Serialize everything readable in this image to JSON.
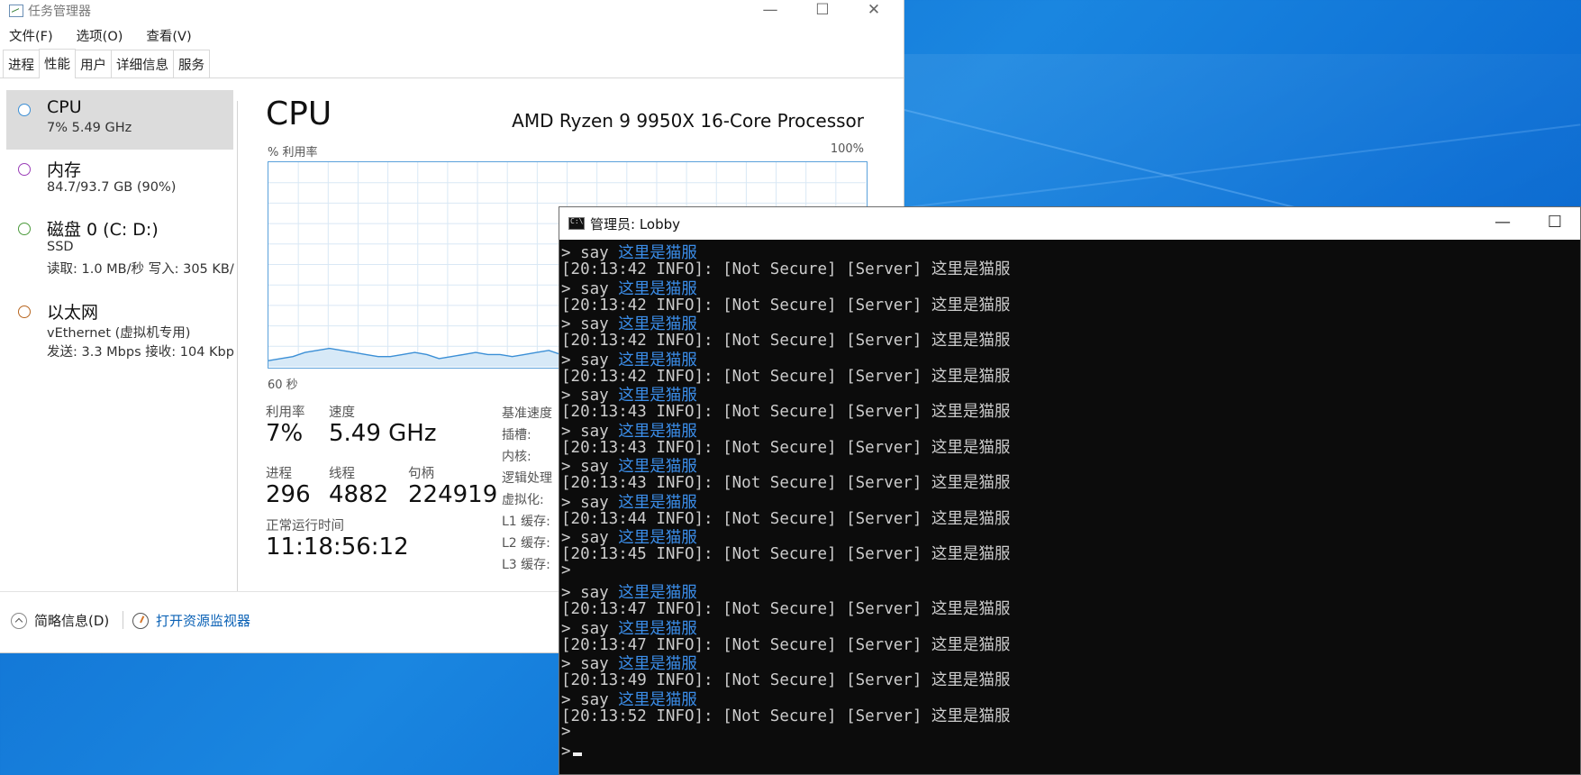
{
  "taskmgr": {
    "title": "任务管理器",
    "controls": {
      "minimize": "—",
      "maximize": "☐",
      "close": "✕"
    },
    "menu": [
      "文件(F)",
      "选项(O)",
      "查看(V)"
    ],
    "tabs": [
      "进程",
      "性能",
      "用户",
      "详细信息",
      "服务"
    ],
    "active_tab": "性能",
    "resources": [
      {
        "name": "CPU",
        "sub1": "7% 5.49 GHz",
        "sub2": ""
      },
      {
        "name": "内存",
        "sub1": "84.7/93.7 GB (90%)",
        "sub2": ""
      },
      {
        "name": "磁盘 0 (C: D:)",
        "sub1": "SSD",
        "sub2": "读取: 1.0 MB/秒 写入: 305 KB/"
      },
      {
        "name": "以太网",
        "sub1": "vEthernet (虚拟机专用)",
        "sub2": "发送: 3.3 Mbps 接收: 104 Kbp"
      }
    ],
    "cpu": {
      "title": "CPU",
      "model": "AMD Ryzen 9 9950X 16-Core Processor",
      "util_label": "% 利用率",
      "util_max": "100%",
      "time_label": "60 秒",
      "stats": {
        "util_label": "利用率",
        "util_value": "7%",
        "speed_label": "速度",
        "speed_value": "5.49 GHz",
        "proc_label": "进程",
        "proc_value": "296",
        "thread_label": "线程",
        "thread_value": "4882",
        "handle_label": "句柄",
        "handle_value": "224919",
        "uptime_label": "正常运行时间",
        "uptime_value": "11:18:56:12"
      },
      "details": [
        "基准速度",
        "插槽:",
        "内核:",
        "逻辑处理",
        "虚拟化:",
        "L1 缓存:",
        "L2 缓存:",
        "L3 缓存:"
      ],
      "graph_values_percent": [
        3,
        4,
        5,
        7,
        8,
        9,
        8,
        7,
        6,
        5,
        5,
        6,
        7,
        6,
        4,
        5,
        6,
        7,
        6,
        6,
        5,
        6,
        7,
        8,
        6,
        7,
        9,
        11,
        9,
        7,
        6,
        7,
        6,
        5,
        8,
        13,
        6,
        5,
        7,
        6,
        7,
        8,
        7,
        6,
        5,
        6,
        7,
        8,
        7,
        6
      ]
    },
    "footer": {
      "fewer_details": "简略信息(D)",
      "open_resmon": "打开资源监视器"
    }
  },
  "console": {
    "title": "管理员:  Lobby",
    "controls": {
      "minimize": "—",
      "maximize": "☐"
    },
    "lines": [
      {
        "type": "cmd",
        "prompt": "> say ",
        "text": "这里是猫服"
      },
      {
        "type": "log",
        "text": "[20:13:42 INFO]: [Not Secure] [Server] 这里是猫服"
      },
      {
        "type": "cmd",
        "prompt": "> say ",
        "text": "这里是猫服"
      },
      {
        "type": "log",
        "text": "[20:13:42 INFO]: [Not Secure] [Server] 这里是猫服"
      },
      {
        "type": "cmd",
        "prompt": "> say ",
        "text": "这里是猫服"
      },
      {
        "type": "log",
        "text": "[20:13:42 INFO]: [Not Secure] [Server] 这里是猫服"
      },
      {
        "type": "cmd",
        "prompt": "> say ",
        "text": "这里是猫服"
      },
      {
        "type": "log",
        "text": "[20:13:42 INFO]: [Not Secure] [Server] 这里是猫服"
      },
      {
        "type": "cmd",
        "prompt": "> say ",
        "text": "这里是猫服"
      },
      {
        "type": "log",
        "text": "[20:13:43 INFO]: [Not Secure] [Server] 这里是猫服"
      },
      {
        "type": "cmd",
        "prompt": "> say ",
        "text": "这里是猫服"
      },
      {
        "type": "log",
        "text": "[20:13:43 INFO]: [Not Secure] [Server] 这里是猫服"
      },
      {
        "type": "cmd",
        "prompt": "> say ",
        "text": "这里是猫服"
      },
      {
        "type": "log",
        "text": "[20:13:43 INFO]: [Not Secure] [Server] 这里是猫服"
      },
      {
        "type": "cmd",
        "prompt": "> say ",
        "text": "这里是猫服"
      },
      {
        "type": "log",
        "text": "[20:13:44 INFO]: [Not Secure] [Server] 这里是猫服"
      },
      {
        "type": "cmd",
        "prompt": "> say ",
        "text": "这里是猫服"
      },
      {
        "type": "log",
        "text": "[20:13:45 INFO]: [Not Secure] [Server] 这里是猫服"
      },
      {
        "type": "cmd",
        "prompt": ">",
        "text": ""
      },
      {
        "type": "cmd",
        "prompt": "> say ",
        "text": "这里是猫服"
      },
      {
        "type": "log",
        "text": "[20:13:47 INFO]: [Not Secure] [Server] 这里是猫服"
      },
      {
        "type": "cmd",
        "prompt": "> say ",
        "text": "这里是猫服"
      },
      {
        "type": "log",
        "text": "[20:13:47 INFO]: [Not Secure] [Server] 这里是猫服"
      },
      {
        "type": "cmd",
        "prompt": "> say ",
        "text": "这里是猫服"
      },
      {
        "type": "log",
        "text": "[20:13:49 INFO]: [Not Secure] [Server] 这里是猫服"
      },
      {
        "type": "cmd",
        "prompt": "> say ",
        "text": "这里是猫服"
      },
      {
        "type": "log",
        "text": "[20:13:52 INFO]: [Not Secure] [Server] 这里是猫服"
      },
      {
        "type": "cmd",
        "prompt": ">",
        "text": ""
      },
      {
        "type": "input",
        "prompt": ">",
        "text": ""
      }
    ]
  },
  "colors": {
    "desktop": "#0d6fd4",
    "graph_line": "#3b8fd6",
    "graph_fill": "#d7e9f7",
    "console_cmd": "#3b8eea",
    "console_text": "#cccccc"
  }
}
